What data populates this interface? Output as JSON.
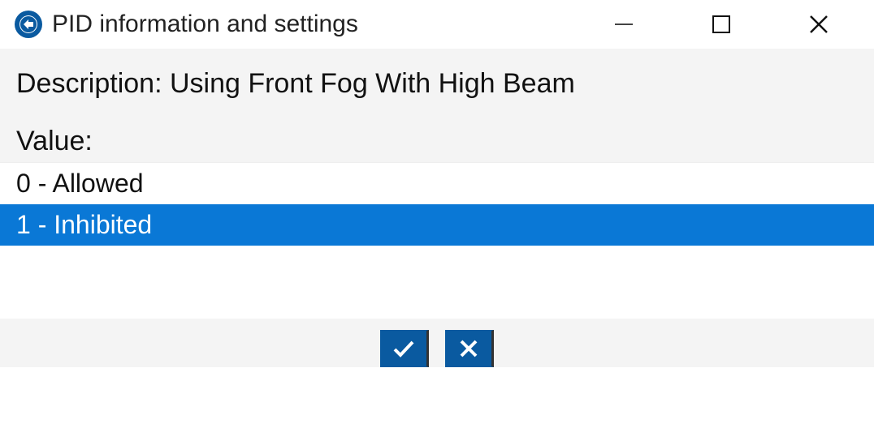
{
  "window": {
    "title": "PID information and settings"
  },
  "description": {
    "label": "Description:",
    "text": "Using Front Fog With High Beam"
  },
  "value": {
    "label": "Value:",
    "options": [
      {
        "code": "0",
        "label": "Allowed",
        "selected": false
      },
      {
        "code": "1",
        "label": "Inhibited",
        "selected": true
      }
    ]
  },
  "buttons": {
    "ok": "OK",
    "cancel": "Cancel"
  }
}
